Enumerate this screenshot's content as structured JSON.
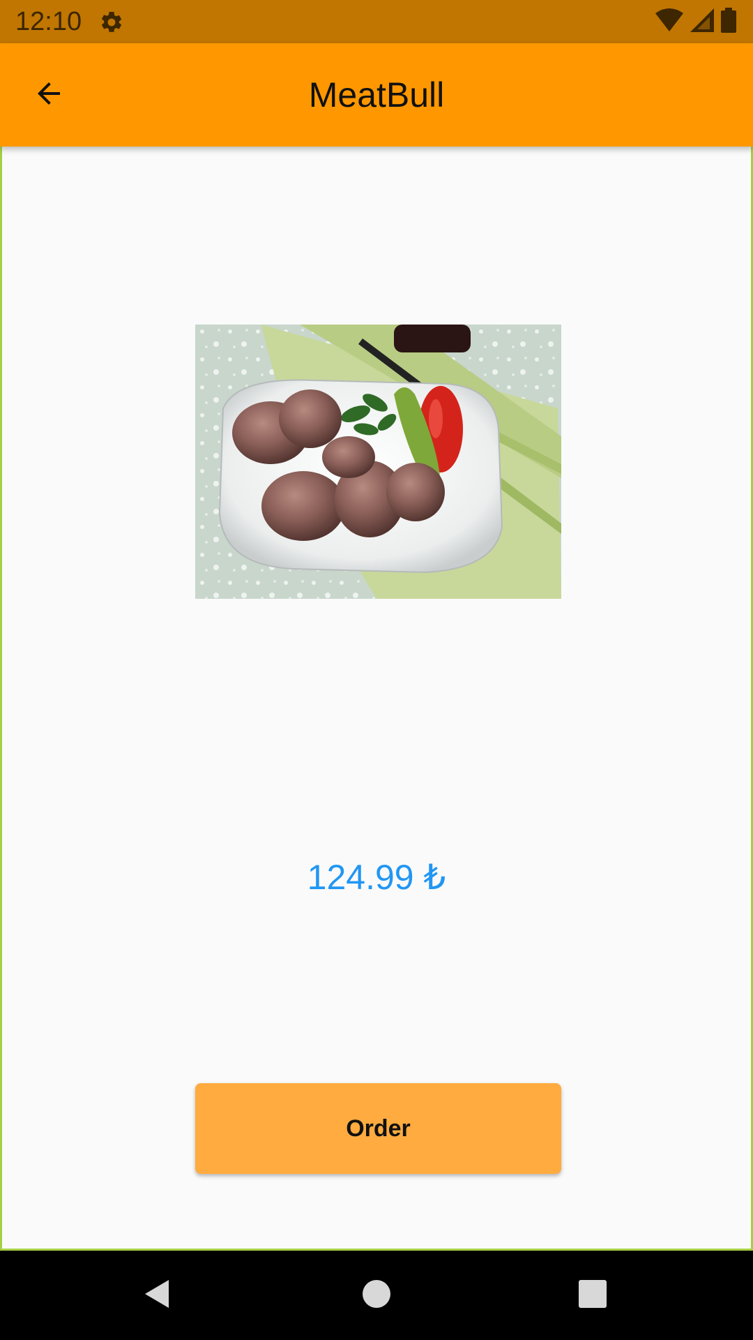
{
  "status_bar": {
    "time": "12:10",
    "icons": [
      "gear-icon",
      "wifi-icon",
      "signal-icon",
      "battery-icon"
    ]
  },
  "app_bar": {
    "title": "MeatBull",
    "back_icon": "arrow-left-icon"
  },
  "product": {
    "image_subject": "plate of meatballs with parsley, grilled green pepper and tomato",
    "price": "124.99 ₺"
  },
  "actions": {
    "order_label": "Order"
  },
  "nav_bar": {
    "icons": [
      "nav-back-icon",
      "nav-home-icon",
      "nav-recents-icon"
    ]
  },
  "colors": {
    "status_bar": "#c07600",
    "app_bar": "#ff9800",
    "order_button": "#ffab40",
    "price_text": "#2196f3",
    "background": "#fafafa"
  }
}
